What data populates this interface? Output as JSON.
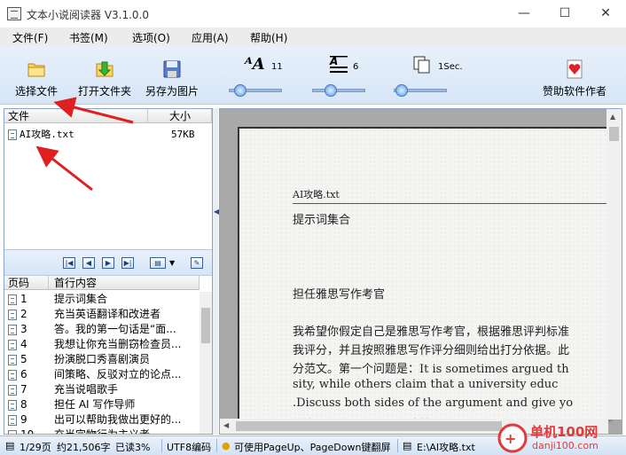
{
  "window": {
    "title": "文本小说阅读器 V3.1.0.0",
    "minimize": "—",
    "maximize": "☐",
    "close": "✕"
  },
  "menu": [
    "文件(F)",
    "书签(M)",
    "选项(O)",
    "应用(A)",
    "帮助(H)"
  ],
  "toolbar": {
    "select_file": "选择文件",
    "open_folder": "打开文件夹",
    "save_as_image": "另存为图片",
    "sponsor": "赞助软件作者",
    "font_size_value": "11",
    "line_spacing_value": "6",
    "interval_value": "1Sec.",
    "font_size_level": 0.12,
    "line_spacing_level": 0.3,
    "interval_level": 0.05
  },
  "file_list": {
    "col_file": "文件",
    "col_size": "大小",
    "rows": [
      {
        "name": "AI攻略.txt",
        "size": "57KB"
      }
    ]
  },
  "page_list": {
    "col_page": "页码",
    "col_first_line": "首行内容",
    "rows": [
      {
        "page": "1",
        "text": "提示词集合"
      },
      {
        "page": "2",
        "text": "充当英语翻译和改进者"
      },
      {
        "page": "3",
        "text": "答。我的第一句话是“面..."
      },
      {
        "page": "4",
        "text": "我想让你充当删窃检查员..."
      },
      {
        "page": "5",
        "text": "扮演脱口秀喜剧演员"
      },
      {
        "page": "6",
        "text": "间策略、反驳对立的论点..."
      },
      {
        "page": "7",
        "text": "充当说唱歌手"
      },
      {
        "page": "8",
        "text": "担任 AI 写作导师"
      },
      {
        "page": "9",
        "text": "出可以帮助我做出更好的..."
      },
      {
        "page": "10",
        "text": "充当完物行为主义者"
      }
    ]
  },
  "reader": {
    "file_header": "AI攻略.txt",
    "lines": [
      "提示词集合",
      "担任雅思写作考官",
      "我希望你假定自己是雅思写作考官，根据雅思评判标准",
      "我评分，并且按照雅思写作评分细则给出打分依据。此",
      "分范文。第一个问题是：It is sometimes argued th",
      "sity, while others claim that a university educ",
      ".Discuss both sides of the argument and give yo",
      "答案即：我一个问题，请按照以上"
    ]
  },
  "status": {
    "page": "1/29页",
    "chars": "约21,506字",
    "read": "已读3%",
    "encoding": "UTF8编码",
    "tip": "可使用PageUp、PageDown键翻屏",
    "path": "E:\\AI攻略.txt"
  },
  "watermark": {
    "site_cn": "单机100网",
    "site_url": "danji100.com"
  },
  "colors": {
    "accent": "#3f7ac0",
    "arrow": "#e02020",
    "watermark": "#e03a3a"
  }
}
